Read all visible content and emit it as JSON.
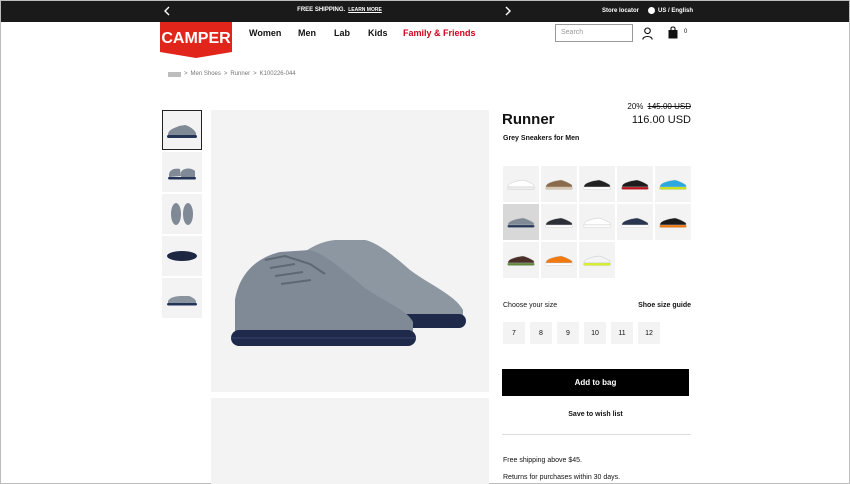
{
  "promo": {
    "message": "FREE SHIPPING.",
    "learn_more": "LEARN MORE",
    "store_locator": "Store locator",
    "language": "US / English"
  },
  "header": {
    "logo_text": "CAMPER",
    "nav": [
      "Women",
      "Men",
      "Lab",
      "Kids",
      "Family & Friends"
    ],
    "search_placeholder": "Search",
    "bag_count": "0"
  },
  "breadcrumb": {
    "items": [
      "Men Shoes",
      "Runner",
      "K100226-044"
    ]
  },
  "product": {
    "title": "Runner",
    "subtitle": "Grey Sneakers for Men",
    "discount": "20%",
    "old_price": "145.00 USD",
    "price": "116.00 USD"
  },
  "swatches": [
    {
      "color": "#ffffff",
      "sole": "#eeeeee"
    },
    {
      "color": "#8a6a4a",
      "sole": "#d9c9b0"
    },
    {
      "color": "#222222",
      "sole": "#ffffff"
    },
    {
      "color": "#1c1c1c",
      "sole": "#c0101a"
    },
    {
      "color": "#29a9e0",
      "sole": "#c9e31b"
    },
    {
      "color": "#7f8a96",
      "sole": "#233457"
    },
    {
      "color": "#2c2f36",
      "sole": "#ffffff"
    },
    {
      "color": "#ffffff",
      "sole": "#ffffff"
    },
    {
      "color": "#2a3550",
      "sole": "#ffffff"
    },
    {
      "color": "#1a1a1a",
      "sole": "#f07a10"
    },
    {
      "color": "#4a2f28",
      "sole": "#5e8a3a"
    },
    {
      "color": "#f07a10",
      "sole": "#ffffff"
    },
    {
      "color": "#f4f4f4",
      "sole": "#d8f22a"
    }
  ],
  "sizes": {
    "label": "Choose your size",
    "guide": "Shoe size guide",
    "options": [
      "7",
      "8",
      "9",
      "10",
      "11",
      "12"
    ]
  },
  "actions": {
    "add_to_bag": "Add to bag",
    "wish_list": "Save to wish list"
  },
  "info": {
    "shipping": "Free shipping above $45.",
    "returns": "Returns for purchases within 30 days."
  }
}
